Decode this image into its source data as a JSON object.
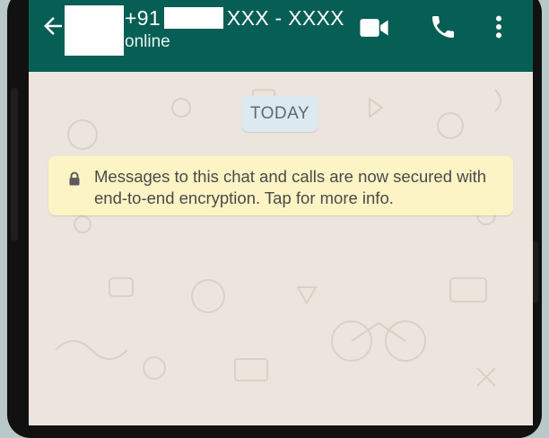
{
  "header": {
    "back_icon": "arrow-left-icon",
    "phone_prefix": "+91",
    "phone_suffix": "XXX - XXXX",
    "status": "online",
    "video_call_icon": "video-camera-icon",
    "voice_call_icon": "phone-icon",
    "menu_icon": "more-vertical-icon"
  },
  "chat": {
    "date_label": "TODAY",
    "encryption_icon": "lock-icon",
    "encryption_message": "Messages to this chat and calls are now secured with end-to-end encryption. Tap for more info."
  },
  "colors": {
    "header": "#075e54",
    "chat_background": "#ece5dd",
    "system_banner": "#fcf4c4",
    "date_chip": "#dde9f1"
  }
}
